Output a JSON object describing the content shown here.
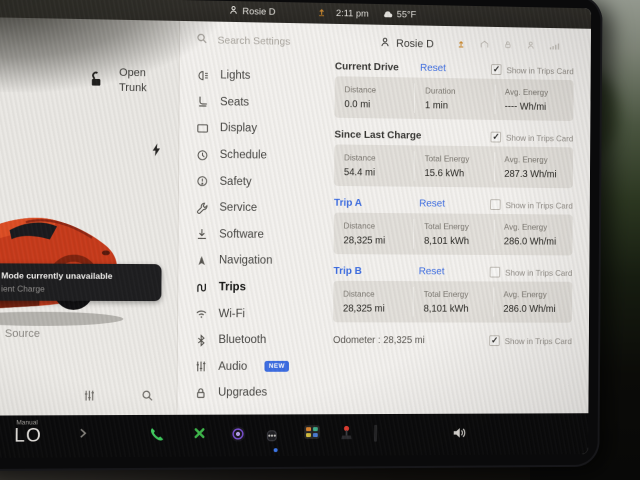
{
  "status_bar": {
    "profile_name": "Rosie D",
    "time": "2:11 pm",
    "temperature": "55°F"
  },
  "vehicle_panel": {
    "trunk_label_line1": "Open",
    "trunk_label_line2": "Trunk",
    "tooltip_title": "Mode currently unavailable",
    "tooltip_subtitle": "ient Charge",
    "media_source_label": "Source"
  },
  "settings": {
    "search_placeholder": "Search Settings",
    "profile_name": "Rosie D",
    "menu": [
      {
        "label": "Lights"
      },
      {
        "label": "Seats"
      },
      {
        "label": "Display"
      },
      {
        "label": "Schedule"
      },
      {
        "label": "Safety"
      },
      {
        "label": "Service"
      },
      {
        "label": "Software"
      },
      {
        "label": "Navigation"
      },
      {
        "label": "Trips"
      },
      {
        "label": "Wi-Fi"
      },
      {
        "label": "Bluetooth"
      },
      {
        "label": "Audio",
        "badge": "NEW"
      },
      {
        "label": "Upgrades"
      }
    ],
    "sections": [
      {
        "title": "Current Drive",
        "reset": "Reset",
        "show": "Show in Trips Card",
        "checked": "✓",
        "stats": [
          {
            "label": "Distance",
            "value": "0.0 mi"
          },
          {
            "label": "Duration",
            "value": "1 min"
          },
          {
            "label": "Avg. Energy",
            "value": "---- Wh/mi"
          }
        ]
      },
      {
        "title": "Since Last Charge",
        "reset": "",
        "show": "Show in Trips Card",
        "checked": "✓",
        "stats": [
          {
            "label": "Distance",
            "value": "54.4 mi"
          },
          {
            "label": "Total Energy",
            "value": "15.6 kWh"
          },
          {
            "label": "Avg. Energy",
            "value": "287.3 Wh/mi"
          }
        ]
      },
      {
        "title": "Trip A",
        "reset": "Reset",
        "show": "Show in Trips Card",
        "checked": "",
        "stats": [
          {
            "label": "Distance",
            "value": "28,325 mi"
          },
          {
            "label": "Total Energy",
            "value": "8,101 kWh"
          },
          {
            "label": "Avg. Energy",
            "value": "286.0 Wh/mi"
          }
        ]
      },
      {
        "title": "Trip B",
        "reset": "Reset",
        "show": "Show in Trips Card",
        "checked": "",
        "stats": [
          {
            "label": "Distance",
            "value": "28,325 mi"
          },
          {
            "label": "Total Energy",
            "value": "8,101 kWh"
          },
          {
            "label": "Avg. Energy",
            "value": "286.0 Wh/mi"
          }
        ]
      }
    ],
    "odometer_label": "Odometer : 28,325 mi",
    "odometer_show": "Show in Trips Card",
    "odometer_checked": "✓"
  },
  "launcher": {
    "temp_mode_label": "Manual",
    "temp_value": "LO",
    "messages_glyph": "•••"
  },
  "colors": {
    "accent_blue": "#3a6be2",
    "update_orange": "#cf8b2e",
    "phone_green": "#3ecf5e",
    "card_grey": "#e2dfda",
    "car_red": "#c63818",
    "tooltip_black": "#1b1b1d"
  }
}
